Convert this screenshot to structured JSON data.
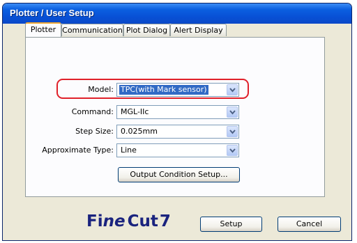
{
  "window": {
    "title": "Plotter / User Setup"
  },
  "tabs": [
    {
      "label": "Plotter",
      "active": true
    },
    {
      "label": "Communication",
      "active": false
    },
    {
      "label": "Plot Dialog",
      "active": false
    },
    {
      "label": "Alert Display",
      "active": false
    }
  ],
  "form": {
    "model": {
      "label": "Model:",
      "value": "TPC(with Mark sensor)"
    },
    "command": {
      "label": "Command:",
      "value": "MGL-IIc"
    },
    "step_size": {
      "label": "Step Size:",
      "value": "0.025mm"
    },
    "approximate_type": {
      "label": "Approximate Type:",
      "value": "Line"
    }
  },
  "buttons": {
    "output_condition": "Output Condition Setup...",
    "setup": "Setup",
    "cancel": "Cancel"
  },
  "logo": {
    "text": "FineCut 7",
    "part1": "Fi",
    "part2": "ne",
    "part3": "Cut",
    "part4": "7"
  },
  "colors": {
    "title_bar": "#0a48c8",
    "highlight": "#e0202a",
    "selection": "#316ac5",
    "logo": "#1a237e"
  },
  "icons": {
    "dropdown": "chevron-down-icon"
  }
}
